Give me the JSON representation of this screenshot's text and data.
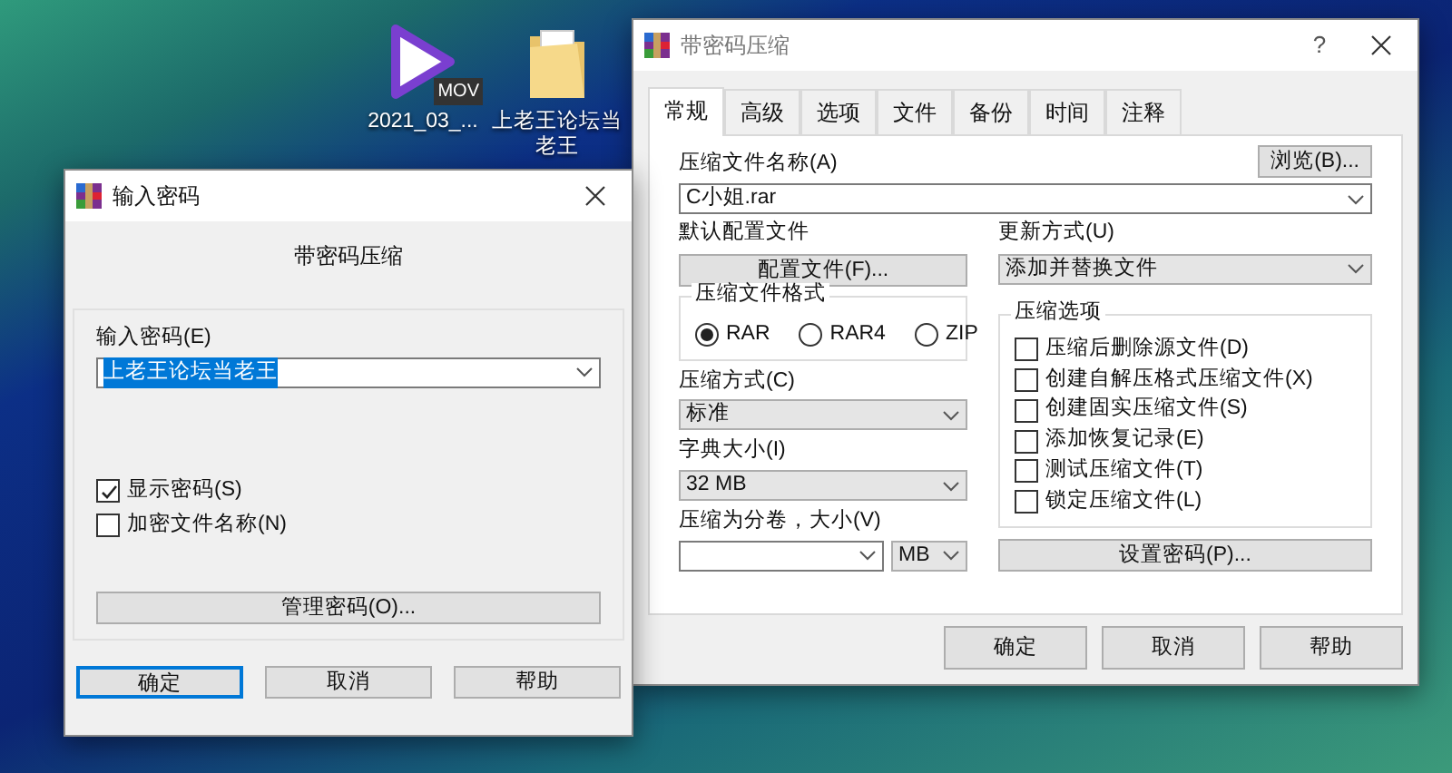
{
  "desktop_icons": [
    {
      "kind": "video",
      "badge": "MOV",
      "label": "2021_03_..."
    },
    {
      "kind": "folder",
      "label": "上老王论坛当老王"
    }
  ],
  "archive_dialog": {
    "title": "带密码压缩",
    "help_glyph": "?",
    "tabs": [
      {
        "label": "常规",
        "selected": true
      },
      {
        "label": "高级",
        "selected": false
      },
      {
        "label": "选项",
        "selected": false
      },
      {
        "label": "文件",
        "selected": false
      },
      {
        "label": "备份",
        "selected": false
      },
      {
        "label": "时间",
        "selected": false
      },
      {
        "label": "注释",
        "selected": false
      }
    ],
    "archive_name": {
      "label": "压缩文件名称(A)",
      "value": "C小姐.rar"
    },
    "browse_button": "浏览(B)...",
    "profile": {
      "label": "默认配置文件",
      "button": "配置文件(F)..."
    },
    "update_mode": {
      "label": "更新方式(U)",
      "value": "添加并替换文件"
    },
    "format": {
      "legend": "压缩文件格式",
      "options": [
        {
          "label": "RAR",
          "selected": true
        },
        {
          "label": "RAR4",
          "selected": false
        },
        {
          "label": "ZIP",
          "selected": false
        }
      ]
    },
    "method": {
      "label": "压缩方式(C)",
      "value": "标准"
    },
    "dictionary": {
      "label": "字典大小(I)",
      "value": "32 MB"
    },
    "volume": {
      "label": "压缩为分卷，大小(V)",
      "unit": "MB"
    },
    "options": {
      "legend": "压缩选项",
      "items": [
        {
          "label": "压缩后删除源文件(D)",
          "checked": false
        },
        {
          "label": "创建自解压格式压缩文件(X)",
          "checked": false
        },
        {
          "label": "创建固实压缩文件(S)",
          "checked": false
        },
        {
          "label": "添加恢复记录(E)",
          "checked": false
        },
        {
          "label": "测试压缩文件(T)",
          "checked": false
        },
        {
          "label": "锁定压缩文件(L)",
          "checked": false
        }
      ]
    },
    "set_password_button": "设置密码(P)...",
    "buttons": [
      {
        "label": "确定",
        "default": false
      },
      {
        "label": "取消",
        "default": false
      },
      {
        "label": "帮助",
        "default": false
      }
    ]
  },
  "password_dialog": {
    "title": "输入密码",
    "heading": "带密码压缩",
    "password": {
      "label": "输入密码(E)",
      "value": "上老王论坛当老王"
    },
    "checks": [
      {
        "label": "显示密码(S)",
        "checked": true
      },
      {
        "label": "加密文件名称(N)",
        "checked": false
      }
    ],
    "manage_button": "管理密码(O)...",
    "buttons": [
      {
        "label": "确定",
        "default": true
      },
      {
        "label": "取消",
        "default": false
      },
      {
        "label": "帮助",
        "default": false
      }
    ]
  }
}
